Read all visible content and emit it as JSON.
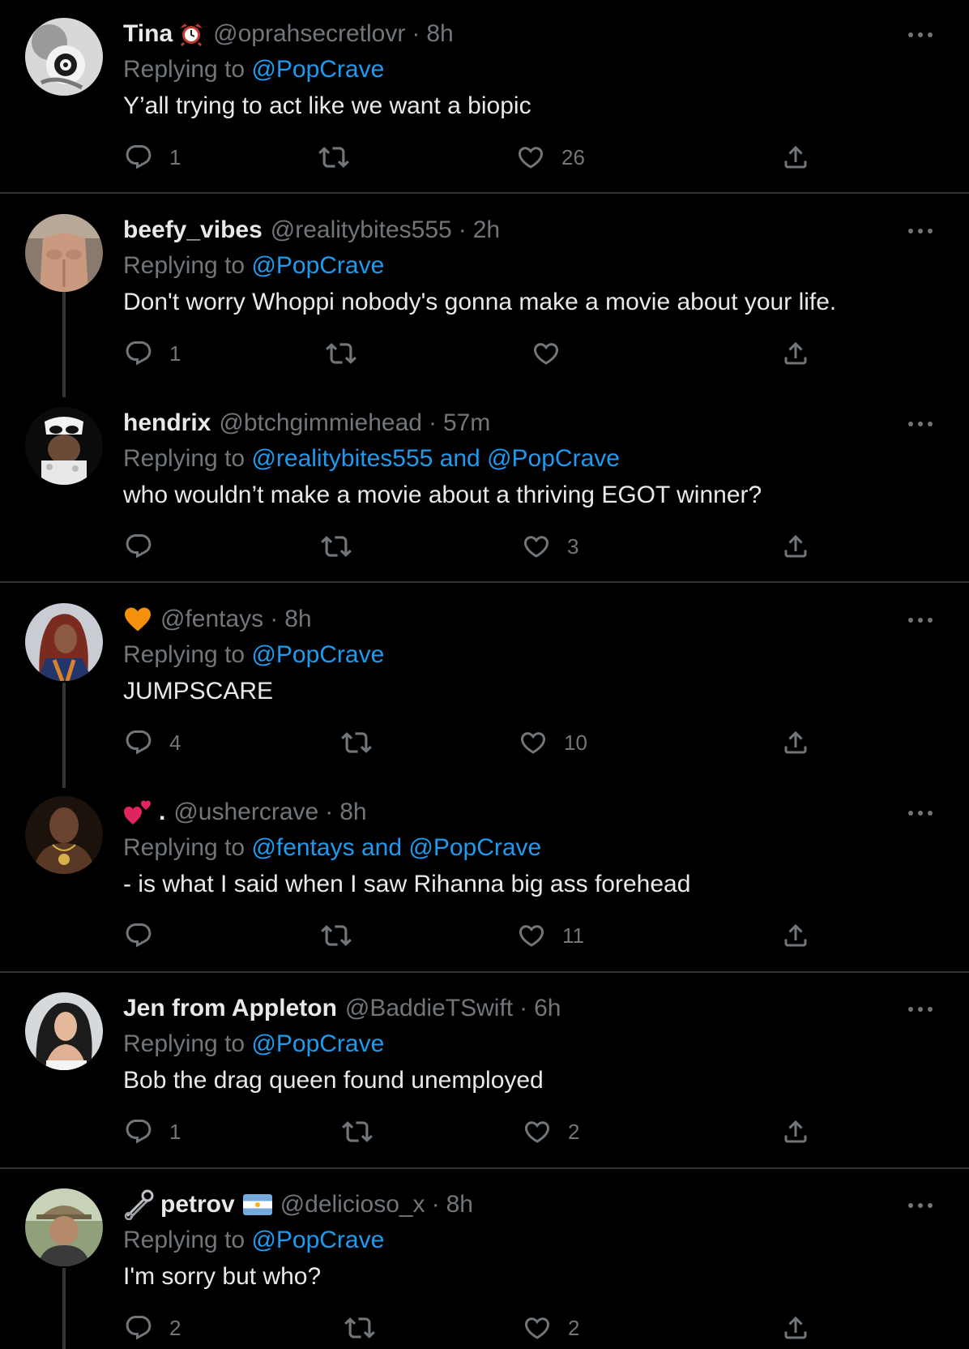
{
  "colors": {
    "background": "#000000",
    "text_primary": "#e7e9ea",
    "text_secondary": "#71767b",
    "link": "#1d9bf0",
    "divider": "#2f3336"
  },
  "icons": {
    "reply": "speech-bubble-outline",
    "retweet": "two-arrow-loop",
    "like": "heart-outline",
    "share": "upload-arrow",
    "more": "horizontal-ellipsis"
  },
  "tweets": [
    {
      "display_name": "Tina",
      "name_emoji": "alarm-clock",
      "handle": "@oprahsecretlovr",
      "dot": "·",
      "time": "8h",
      "replying_prefix": "Replying to ",
      "mentions": [
        "@PopCrave"
      ],
      "and_word": "",
      "text": "Y’all trying to act like we want a biopic",
      "reply_count": "1",
      "retweet_count": "",
      "like_count": "26"
    },
    {
      "display_name": "beefy_vibes",
      "handle": "@realitybites555",
      "dot": "·",
      "time": "2h",
      "replying_prefix": "Replying to ",
      "mentions": [
        "@PopCrave"
      ],
      "and_word": "",
      "text": "Don't worry Whoppi nobody's gonna make a movie about your life.",
      "reply_count": "1",
      "retweet_count": "",
      "like_count": ""
    },
    {
      "display_name": "hendrix",
      "handle": "@btchgimmiehead",
      "dot": "·",
      "time": "57m",
      "replying_prefix": "Replying to ",
      "mentions": [
        "@realitybites555",
        "@PopCrave"
      ],
      "and_word": "and",
      "text": "who wouldn’t make a movie about a thriving EGOT winner?",
      "reply_count": "",
      "retweet_count": "",
      "like_count": "3"
    },
    {
      "display_name": "",
      "name_emoji": "orange-heart",
      "handle": "@fentays",
      "dot": "·",
      "time": "8h",
      "replying_prefix": "Replying to ",
      "mentions": [
        "@PopCrave"
      ],
      "and_word": "",
      "text": "JUMPSCARE",
      "reply_count": "4",
      "retweet_count": "",
      "like_count": "10"
    },
    {
      "display_name": ".",
      "name_emoji": "two-hearts",
      "handle": "@ushercrave",
      "dot": "·",
      "time": "8h",
      "replying_prefix": "Replying to ",
      "mentions": [
        "@fentays",
        "@PopCrave"
      ],
      "and_word": "and",
      "text": "- is what I said when I saw Rihanna big ass forehead",
      "reply_count": "",
      "retweet_count": "",
      "like_count": "11"
    },
    {
      "display_name": "Jen from Appleton",
      "handle": "@BaddieTSwift",
      "dot": "·",
      "time": "6h",
      "replying_prefix": "Replying to ",
      "mentions": [
        "@PopCrave"
      ],
      "and_word": "",
      "text": "Bob the drag queen found unemployed",
      "reply_count": "1",
      "retweet_count": "",
      "like_count": "2"
    },
    {
      "display_name": "petrov",
      "name_emoji": "safety-pin",
      "flag_emoji": "flag-argentina",
      "handle": "@delicioso_x",
      "dot": "·",
      "time": "8h",
      "replying_prefix": "Replying to ",
      "mentions": [
        "@PopCrave"
      ],
      "and_word": "",
      "text": "I'm sorry but who?",
      "reply_count": "2",
      "retweet_count": "",
      "like_count": "2"
    }
  ]
}
